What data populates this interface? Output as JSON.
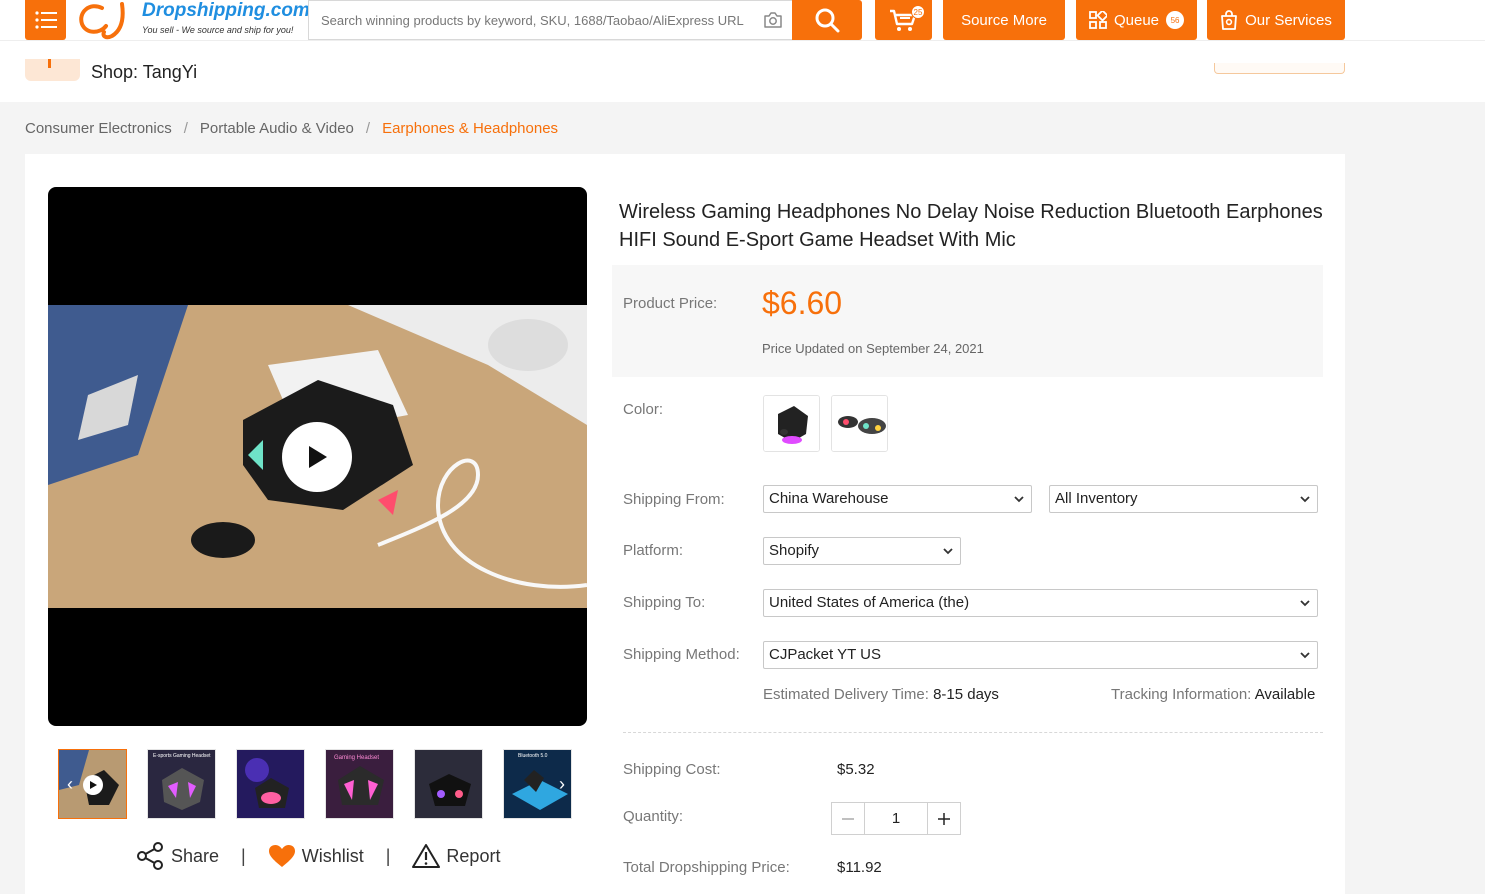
{
  "header": {
    "brand_name": "Dropshipping.com",
    "brand_slogan": "You sell - We source and ship for you!",
    "search_placeholder": "Search winning products by keyword, SKU, 1688/Taobao/AliExpress URL",
    "cart_count": "25",
    "source_more_label": "Source More",
    "queue_label": "Queue",
    "queue_count": "56",
    "services_label": "Our Services",
    "accent_color": "#f7700b"
  },
  "shop": {
    "name": "Shop: TangYi"
  },
  "breadcrumb": [
    "Consumer Electronics",
    "Portable Audio & Video",
    "Earphones & Headphones"
  ],
  "product": {
    "title": "Wireless Gaming Headphones No Delay Noise Reduction Bluetooth Earphones HIFI Sound E-Sport Game Headset With Mic",
    "price_label": "Product Price:",
    "price": "$6.60",
    "price_updated": "Price Updated on September 24, 2021",
    "color_label": "Color:",
    "shipping_from_label": "Shipping From:",
    "shipping_from": "China Warehouse",
    "inventory": "All Inventory",
    "platform_label": "Platform:",
    "platform": "Shopify",
    "shipping_to_label": "Shipping To:",
    "shipping_to": "United States of America (the)",
    "shipping_method_label": "Shipping Method:",
    "shipping_method": "CJPacket YT US",
    "delivery_label": "Estimated Delivery Time:",
    "delivery_value": "8-15 days",
    "tracking_label": "Tracking Information:",
    "tracking_value": "Available",
    "shipping_cost_label": "Shipping Cost:",
    "shipping_cost": "$5.32",
    "quantity_label": "Quantity:",
    "quantity": "1",
    "total_label": "Total Dropshipping Price:",
    "total": "$11.92"
  },
  "gallery_thumb_captions": [
    "E-sports Gaming Headset",
    "Gaming Headset",
    "Bluetooth 5.0"
  ],
  "actions": {
    "share": "Share",
    "wishlist": "Wishlist",
    "report": "Report"
  }
}
